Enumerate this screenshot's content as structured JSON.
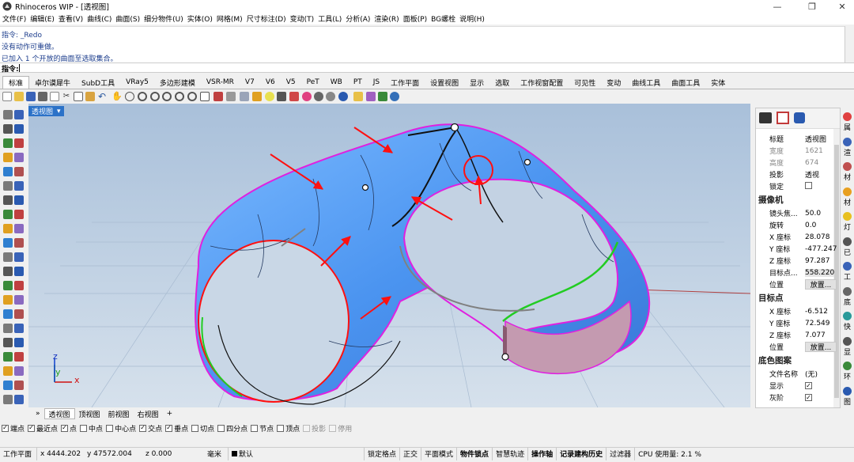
{
  "title": {
    "text": "Rhinoceros WIP - [透视图]"
  },
  "menu": [
    "文件(F)",
    "编辑(E)",
    "查看(V)",
    "曲线(C)",
    "曲面(S)",
    "细分物件(U)",
    "实体(O)",
    "网格(M)",
    "尺寸标注(D)",
    "变动(T)",
    "工具(L)",
    "分析(A)",
    "渲染(R)",
    "面板(P)",
    "BG螺栓",
    "说明(H)"
  ],
  "command": {
    "history": [
      "指令: _Redo",
      "没有动作可重做。",
      "已加入 1 个开放的曲面至选取集合。"
    ],
    "prompt": "指令:"
  },
  "tabs": [
    "标准",
    "卓尔谟犀牛",
    "SubD工具",
    "VRay5",
    "多边形建模",
    "VSR-MR",
    "V7",
    "V6",
    "V5",
    "PeT",
    "WB",
    "PT",
    "JS",
    "工作平面",
    "设置视图",
    "显示",
    "选取",
    "工作视窗配置",
    "可见性",
    "变动",
    "曲线工具",
    "曲面工具",
    "实体"
  ],
  "viewport": {
    "label": "透视图",
    "dropdown_icon": "chevron-down-icon",
    "axes": {
      "x": "x",
      "y": "y",
      "z": "z"
    },
    "tabs": [
      "透视图",
      "顶视图",
      "前视图",
      "右视图"
    ],
    "add_tab": "+",
    "more_tab": "»"
  },
  "osnap": [
    {
      "label": "端点",
      "checked": true,
      "enabled": true
    },
    {
      "label": "最近点",
      "checked": true,
      "enabled": true
    },
    {
      "label": "点",
      "checked": true,
      "enabled": true
    },
    {
      "label": "中点",
      "checked": false,
      "enabled": true
    },
    {
      "label": "中心点",
      "checked": false,
      "enabled": true
    },
    {
      "label": "交点",
      "checked": true,
      "enabled": true
    },
    {
      "label": "垂点",
      "checked": true,
      "enabled": true
    },
    {
      "label": "切点",
      "checked": false,
      "enabled": true
    },
    {
      "label": "四分点",
      "checked": false,
      "enabled": true
    },
    {
      "label": "节点",
      "checked": false,
      "enabled": true
    },
    {
      "label": "顶点",
      "checked": false,
      "enabled": true
    },
    {
      "label": "投影",
      "checked": false,
      "enabled": false
    },
    {
      "label": "停用",
      "checked": false,
      "enabled": false
    }
  ],
  "status": {
    "cplane": "工作平面",
    "x": "x 4444.202",
    "y": "y 47572.004",
    "z": "z 0.000",
    "unit": "毫米",
    "layer": "默认",
    "toggles": [
      "锁定格点",
      "正交",
      "平面模式",
      "物件锁点",
      "智慧轨迹",
      "操作轴",
      "记录建构历史",
      "过滤器"
    ],
    "bold_toggles": [
      "物件锁点",
      "操作轴",
      "记录建构历史"
    ],
    "cpu": "CPU 使用量: 2.1 %"
  },
  "panel": {
    "tabs_icons": [
      "camera-icon",
      "rectangle-icon",
      "wrench-icon"
    ],
    "properties": [
      {
        "k": "标题",
        "v": "透视图"
      },
      {
        "k": "宽度",
        "v": "1621",
        "dim": true
      },
      {
        "k": "高度",
        "v": "674",
        "dim": true
      },
      {
        "k": "投影",
        "v": "透视"
      },
      {
        "k": "锁定",
        "v": ""
      }
    ],
    "camera_title": "摄像机",
    "camera": [
      {
        "k": "镜头焦...",
        "v": "50.0"
      },
      {
        "k": "旋转",
        "v": "0.0"
      },
      {
        "k": "X 座标",
        "v": "28.078"
      },
      {
        "k": "Y 座标",
        "v": "-477.247"
      },
      {
        "k": "Z 座标",
        "v": "97.287"
      },
      {
        "k": "目标点...",
        "v": "558.220"
      },
      {
        "k": "位置",
        "v": "放置..."
      }
    ],
    "target_title": "目标点",
    "target": [
      {
        "k": "X 座标",
        "v": "-6.512"
      },
      {
        "k": "Y 座标",
        "v": "72.549"
      },
      {
        "k": "Z 座标",
        "v": "7.077"
      },
      {
        "k": "位置",
        "v": "放置..."
      }
    ],
    "bg_title": "底色图案",
    "bg": [
      {
        "k": "文件名称",
        "v": "(无)"
      },
      {
        "k": "显示",
        "v": "✓"
      },
      {
        "k": "灰阶",
        "v": "✓"
      }
    ]
  },
  "right_tabs": [
    "属",
    "渲",
    "材",
    "材",
    "灯",
    "已",
    "工",
    "底",
    "快",
    "显",
    "环",
    "图"
  ],
  "colors": {
    "accent": "#2b72c8",
    "surface": "#5aa4f5",
    "edge": "#e020e0",
    "red": "#ff1010",
    "green": "#22cc22"
  }
}
